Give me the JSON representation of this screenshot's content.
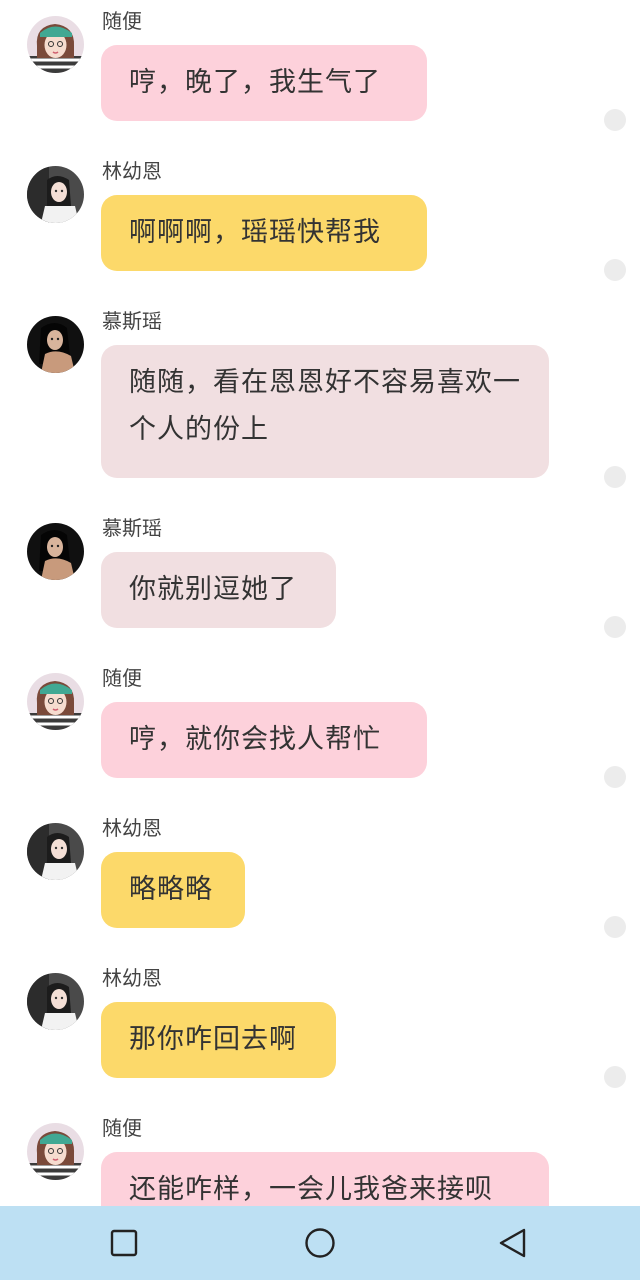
{
  "messages": [
    {
      "sender": "随便",
      "text": "哼，晚了，我生气了",
      "avatar": "avatar-suibian"
    },
    {
      "sender": "林幼恩",
      "text": "啊啊啊，瑶瑶快帮我",
      "avatar": "avatar-linyouen"
    },
    {
      "sender": "慕斯瑶",
      "text": "随随，看在恩恩好不容易喜欢一个人的份上",
      "avatar": "avatar-musiyao"
    },
    {
      "sender": "慕斯瑶",
      "text": "你就别逗她了",
      "avatar": "avatar-musiyao"
    },
    {
      "sender": "随便",
      "text": "哼，就你会找人帮忙",
      "avatar": "avatar-suibian"
    },
    {
      "sender": "林幼恩",
      "text": "略略略",
      "avatar": "avatar-linyouen"
    },
    {
      "sender": "林幼恩",
      "text": "那你咋回去啊",
      "avatar": "avatar-linyouen"
    },
    {
      "sender": "随便",
      "text": "还能咋样，一会儿我爸来接呗",
      "avatar": "avatar-suibian"
    }
  ],
  "navbar": {
    "recents_icon": "square-icon",
    "home_icon": "circle-icon",
    "back_icon": "triangle-back-icon"
  },
  "colors": {
    "bubble_pink": "#fdd1db",
    "bubble_yellow": "#fcd96a",
    "bubble_lavender": "#f1dfe1",
    "navbar_background": "#bde0f3"
  }
}
